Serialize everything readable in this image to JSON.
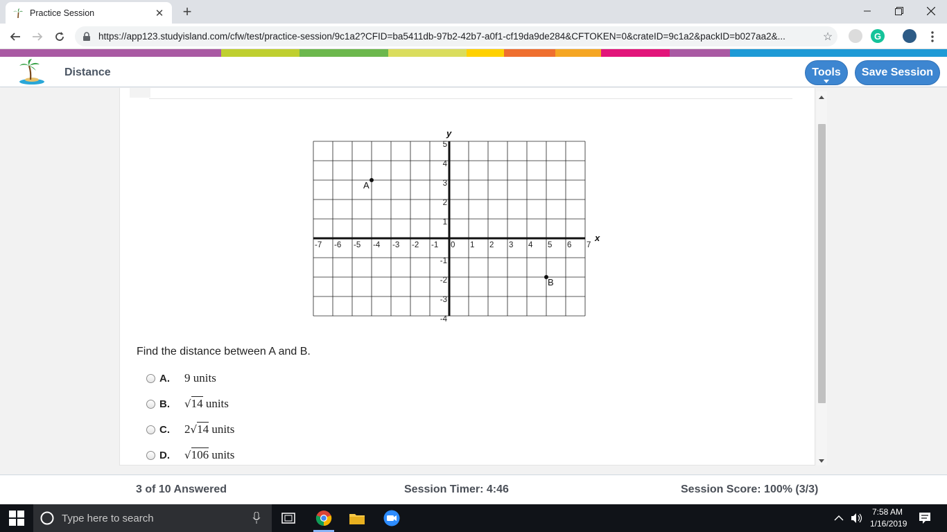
{
  "browser": {
    "tab_title": "Practice Session",
    "url": "https://app123.studyisland.com/cfw/test/practice-session/9c1a2?CFID=ba5411db-97b2-42b7-a0f1-cf19da9de284&CFTOKEN=0&crateID=9c1a2&packID=b027aa2&..."
  },
  "stripe_colors": [
    "#a959a3",
    "#bfcf2f",
    "#6cb84d",
    "#dadd5d",
    "#ffd100",
    "#ef6f2f",
    "#f5a623",
    "#e2157a",
    "#a959a3",
    "#1e9ad6"
  ],
  "header": {
    "title": "Distance",
    "tools_label": "Tools",
    "save_label": "Save Session",
    "button_color": "#3d86d1"
  },
  "chart_data": {
    "type": "scatter",
    "xlabel": "x",
    "ylabel": "y",
    "xlim": [
      -7,
      7
    ],
    "ylim": [
      -4,
      5
    ],
    "x_ticks": [
      "-7",
      "-6",
      "-5",
      "-4",
      "-3",
      "-2",
      "-1",
      "0",
      "1",
      "2",
      "3",
      "4",
      "5",
      "6",
      "7"
    ],
    "y_ticks": [
      "5",
      "4",
      "3",
      "2",
      "1",
      "-1",
      "-2",
      "-3",
      "-4"
    ],
    "grid": true,
    "points": [
      {
        "label": "A",
        "x": -4,
        "y": 3
      },
      {
        "label": "B",
        "x": 5,
        "y": -2
      }
    ]
  },
  "question": {
    "text": "Find the distance between A and B.",
    "choices": [
      {
        "letter": "A.",
        "coef": "",
        "radicand": "",
        "value": "9",
        "unit": "units"
      },
      {
        "letter": "B.",
        "coef": "",
        "radicand": "14",
        "value": "",
        "unit": "units"
      },
      {
        "letter": "C.",
        "coef": "2",
        "radicand": "14",
        "value": "",
        "unit": "units"
      },
      {
        "letter": "D.",
        "coef": "",
        "radicand": "106",
        "value": "",
        "unit": "units"
      }
    ]
  },
  "status": {
    "answered": "3 of 10 Answered",
    "timer": "Session Timer: 4:46",
    "score": "Session Score: 100% (3/3)"
  },
  "taskbar": {
    "search_placeholder": "Type here to search",
    "time": "7:58 AM",
    "date": "1/16/2019"
  }
}
